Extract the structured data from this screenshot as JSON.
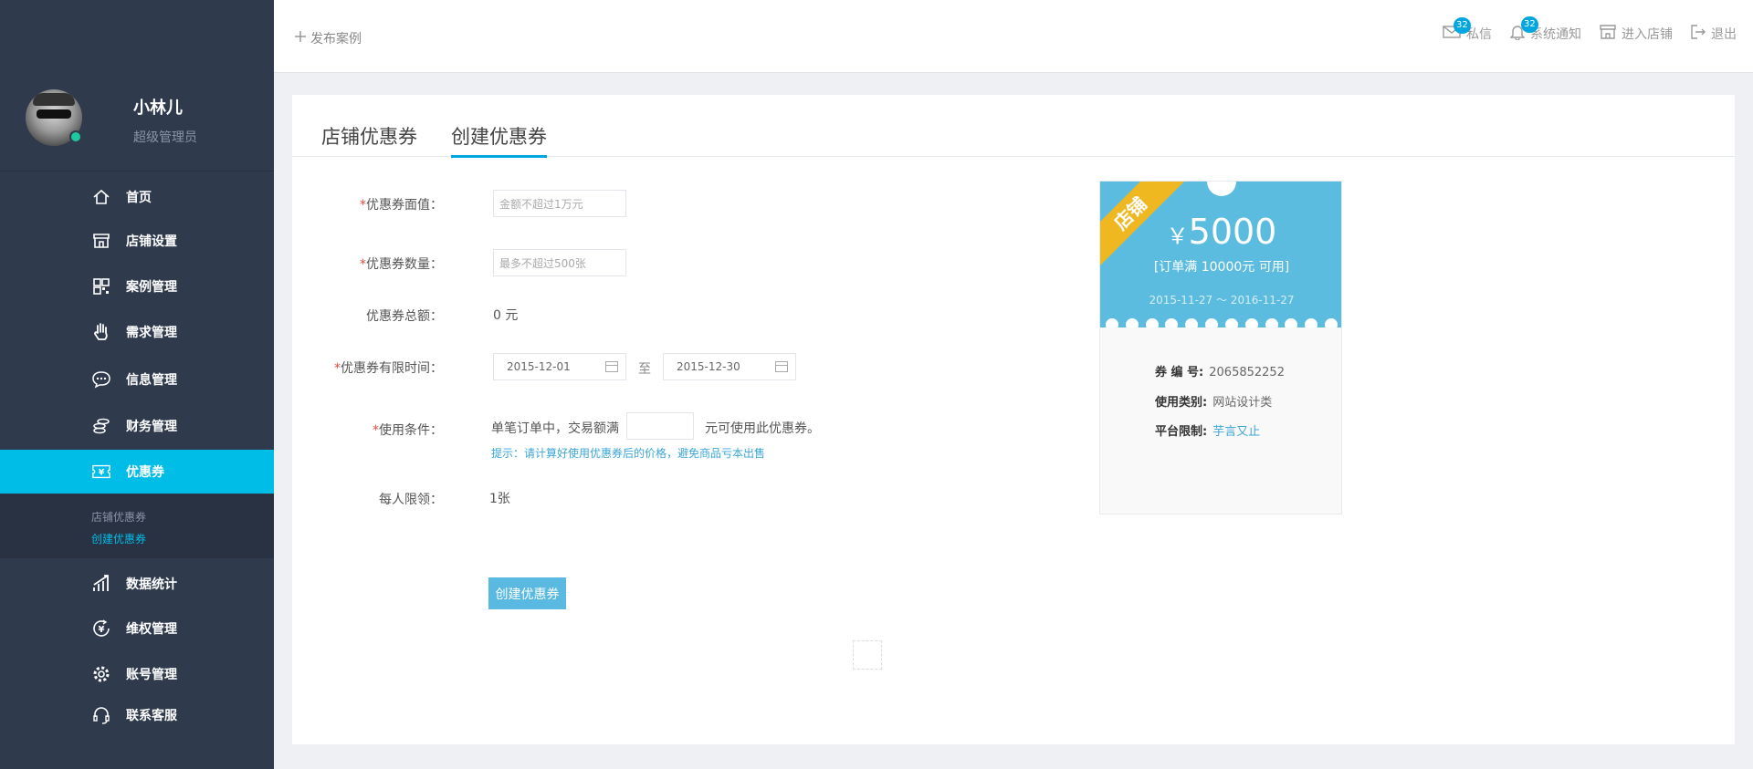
{
  "sidebar": {
    "user": {
      "name": "小林儿",
      "role": "超级管理员"
    },
    "items": [
      {
        "label": "首页",
        "icon": "home-icon"
      },
      {
        "label": "店铺设置",
        "icon": "store-icon"
      },
      {
        "label": "案例管理",
        "icon": "grid-icon"
      },
      {
        "label": "需求管理",
        "icon": "hand-icon"
      },
      {
        "label": "信息管理",
        "icon": "chat-icon"
      },
      {
        "label": "财务管理",
        "icon": "coins-icon"
      },
      {
        "label": "优惠券",
        "icon": "coupon-icon",
        "active": true
      },
      {
        "label": "数据统计",
        "icon": "chart-icon"
      },
      {
        "label": "维权管理",
        "icon": "yen-icon"
      },
      {
        "label": "账号管理",
        "icon": "gear-icon"
      },
      {
        "label": "联系客服",
        "icon": "headset-icon"
      }
    ],
    "submenu": [
      "店铺优惠券",
      "创建优惠券"
    ]
  },
  "header": {
    "publish": "发布案例",
    "links": [
      {
        "label": "私信",
        "badge": "32",
        "icon": "mail-icon"
      },
      {
        "label": "系统通知",
        "badge": "32",
        "icon": "bell-icon"
      },
      {
        "label": "进入店铺",
        "icon": "shop-icon"
      },
      {
        "label": "退出",
        "icon": "logout-icon"
      }
    ]
  },
  "tabs": [
    "店铺优惠券",
    "创建优惠券"
  ],
  "form": {
    "value_label": "优惠券面值：",
    "value_placeholder": "金额不超过1万元",
    "qty_label": "优惠券数量：",
    "qty_placeholder": "最多不超过500张",
    "total_label": "优惠券总额：",
    "total_value": "0 元",
    "period_label": "优惠券有限时间：",
    "start_date": "2015-12-01",
    "to": "至",
    "end_date": "2015-12-30",
    "cond_label": "使用条件：",
    "cond_prefix": "单笔订单中，交易额满",
    "cond_suffix": "元可使用此优惠券。",
    "hint": "提示：请计算好使用优惠券后的价格，避免商品亏本出售",
    "limit_label": "每人限领：",
    "limit_value": "1张",
    "submit": "创建优惠券"
  },
  "coupon": {
    "ribbon": "店铺",
    "currency": "￥",
    "amount": "5000",
    "condition": "[订单满 10000元 可用]",
    "dates": "2015-11-27 ～ 2016-11-27",
    "rows": [
      {
        "key": "券 编 号:",
        "value": "2065852252"
      },
      {
        "key": "使用类别:",
        "value": "网站设计类"
      },
      {
        "key": "平台限制:",
        "value": "芋言又止"
      }
    ]
  },
  "colors": {
    "sidebar": "#2f3a4d",
    "accent": "#00bde8",
    "coupon": "#5bbce0",
    "ribbon": "#f0b820"
  }
}
